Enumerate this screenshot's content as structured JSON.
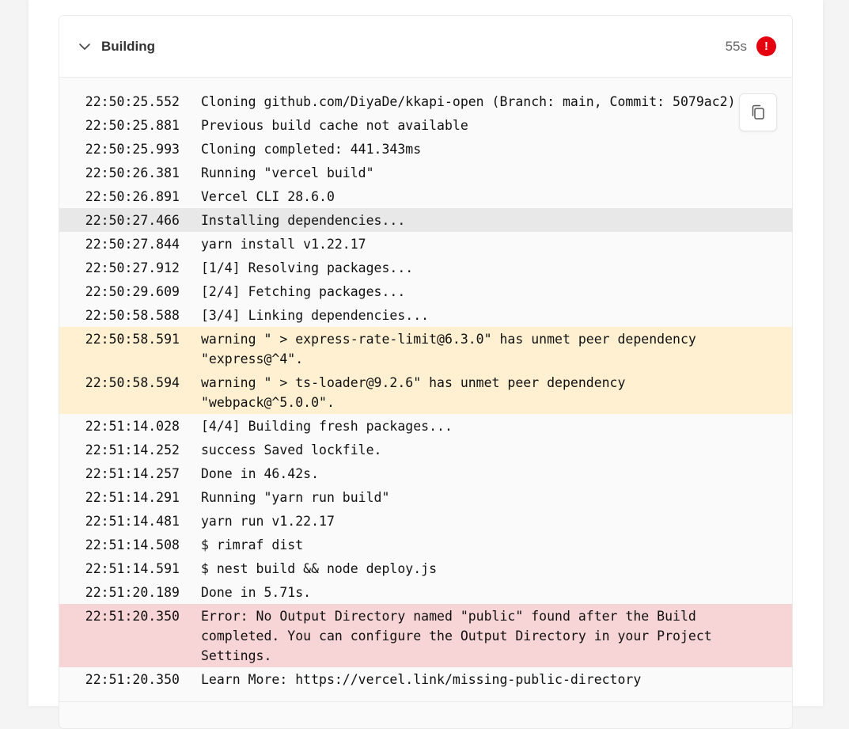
{
  "header": {
    "title": "Building",
    "duration": "55s",
    "status_icon_text": "!",
    "status_color": "#e5000f",
    "chevron_icon": "chevron-down-icon"
  },
  "copy_icon": "copy-icon",
  "logs": [
    {
      "time": "22:50:25.552",
      "message": "Cloning github.com/DiyaDe/kkapi-open (Branch: main, Commit: 5079ac2)",
      "kind": "normal"
    },
    {
      "time": "22:50:25.881",
      "message": "Previous build cache not available",
      "kind": "normal"
    },
    {
      "time": "22:50:25.993",
      "message": "Cloning completed: 441.343ms",
      "kind": "normal"
    },
    {
      "time": "22:50:26.381",
      "message": "Running \"vercel build\"",
      "kind": "normal"
    },
    {
      "time": "22:50:26.891",
      "message": "Vercel CLI 28.6.0",
      "kind": "normal"
    },
    {
      "time": "22:50:27.466",
      "message": "Installing dependencies...",
      "kind": "highlight"
    },
    {
      "time": "22:50:27.844",
      "message": "yarn install v1.22.17",
      "kind": "normal"
    },
    {
      "time": "22:50:27.912",
      "message": "[1/4] Resolving packages...",
      "kind": "normal"
    },
    {
      "time": "22:50:29.609",
      "message": "[2/4] Fetching packages...",
      "kind": "normal"
    },
    {
      "time": "22:50:58.588",
      "message": "[3/4] Linking dependencies...",
      "kind": "normal"
    },
    {
      "time": "22:50:58.591",
      "message": "warning \" > express-rate-limit@6.3.0\" has unmet peer dependency \"express@^4\".",
      "kind": "warning"
    },
    {
      "time": "22:50:58.594",
      "message": "warning \" > ts-loader@9.2.6\" has unmet peer dependency \"webpack@^5.0.0\".",
      "kind": "warning"
    },
    {
      "time": "22:51:14.028",
      "message": "[4/4] Building fresh packages...",
      "kind": "normal"
    },
    {
      "time": "22:51:14.252",
      "message": "success Saved lockfile.",
      "kind": "normal"
    },
    {
      "time": "22:51:14.257",
      "message": "Done in 46.42s.",
      "kind": "normal"
    },
    {
      "time": "22:51:14.291",
      "message": "Running \"yarn run build\"",
      "kind": "normal"
    },
    {
      "time": "22:51:14.481",
      "message": "yarn run v1.22.17",
      "kind": "normal"
    },
    {
      "time": "22:51:14.508",
      "message": "$ rimraf dist",
      "kind": "normal"
    },
    {
      "time": "22:51:14.591",
      "message": "$ nest build && node deploy.js",
      "kind": "normal"
    },
    {
      "time": "22:51:20.189",
      "message": "Done in 5.71s.",
      "kind": "normal"
    },
    {
      "time": "22:51:20.350",
      "message": "Error: No Output Directory named \"public\" found after the Build completed. You can configure the Output Directory in your Project Settings.",
      "kind": "error"
    },
    {
      "time": "22:51:20.350",
      "message": "Learn More: https://vercel.link/missing-public-directory",
      "kind": "normal"
    }
  ],
  "colors": {
    "highlight_row": "#e8e8e8",
    "warning_row": "#fff0d1",
    "error_row": "#f7d4d6"
  }
}
